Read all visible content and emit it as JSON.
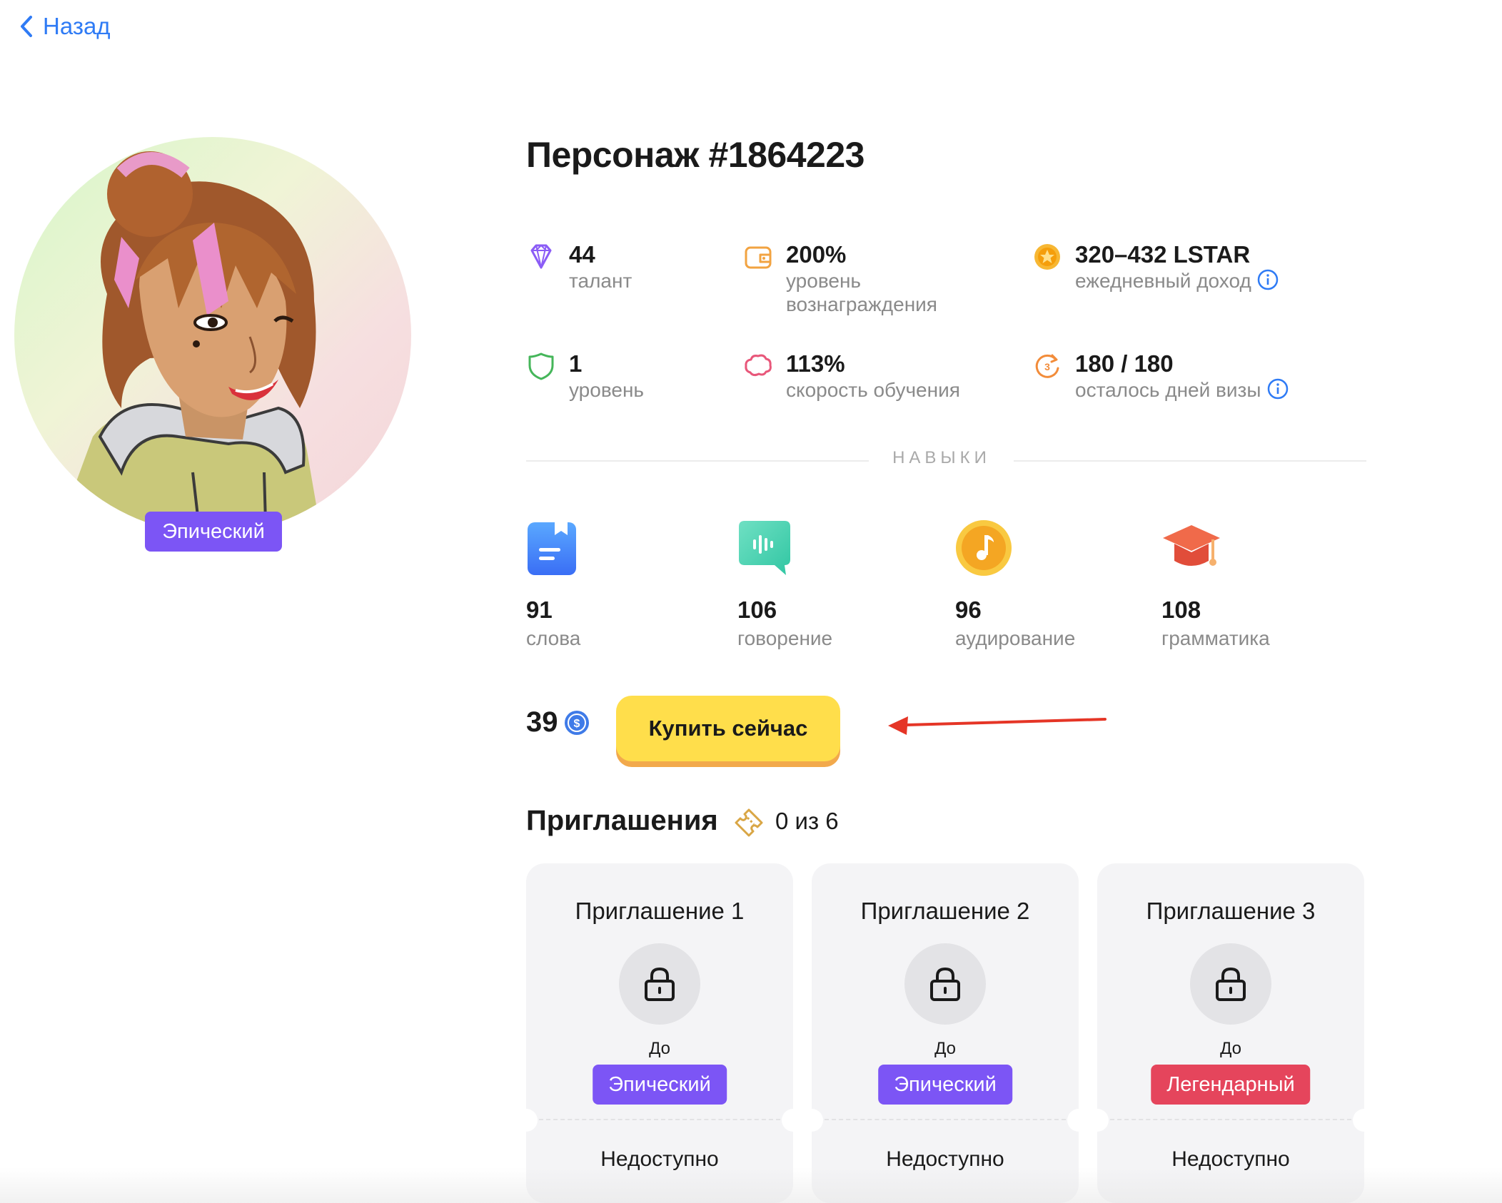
{
  "nav": {
    "back_label": "Назад"
  },
  "character": {
    "title": "Персонаж #1864223",
    "rarity_badge": "Эпический",
    "rarity_color": "#7c55f5"
  },
  "stats": [
    {
      "icon": "diamond-icon",
      "value": "44",
      "label": "талант"
    },
    {
      "icon": "wallet-icon",
      "value": "200%",
      "label": "уровень вознаграждения"
    },
    {
      "icon": "coin-icon",
      "value": "320–432 LSTAR",
      "label": "ежедневный доход",
      "has_info": true
    },
    {
      "icon": "shield-icon",
      "value": "1",
      "label": "уровень"
    },
    {
      "icon": "brain-icon",
      "value": "113%",
      "label": "скорость обучения"
    },
    {
      "icon": "visa-days-icon",
      "value": "180 / 180",
      "label": "осталось дней визы",
      "has_info": true
    }
  ],
  "skills_heading": "НАВЫКИ",
  "skills": [
    {
      "icon": "words-icon",
      "value": "91",
      "label": "слова"
    },
    {
      "icon": "speaking-icon",
      "value": "106",
      "label": "говорение"
    },
    {
      "icon": "listening-icon",
      "value": "96",
      "label": "аудирование"
    },
    {
      "icon": "grammar-icon",
      "value": "108",
      "label": "грамматика"
    }
  ],
  "purchase": {
    "price": "39",
    "buy_label": "Купить сейчас",
    "button_color": "#ffde4b"
  },
  "invitations": {
    "title": "Приглашения",
    "count": "0 из 6",
    "cards": [
      {
        "title": "Приглашение 1",
        "until": "До",
        "badge": "Эпический",
        "badge_color": "#7c55f5",
        "status": "Недоступно"
      },
      {
        "title": "Приглашение 2",
        "until": "До",
        "badge": "Эпический",
        "badge_color": "#7c55f5",
        "status": "Недоступно"
      },
      {
        "title": "Приглашение 3",
        "until": "До",
        "badge": "Легендарный",
        "badge_color": "#e5455c",
        "status": "Недоступно"
      }
    ]
  },
  "colors": {
    "link": "#2f7bf5",
    "annotation_arrow": "#e53526"
  }
}
